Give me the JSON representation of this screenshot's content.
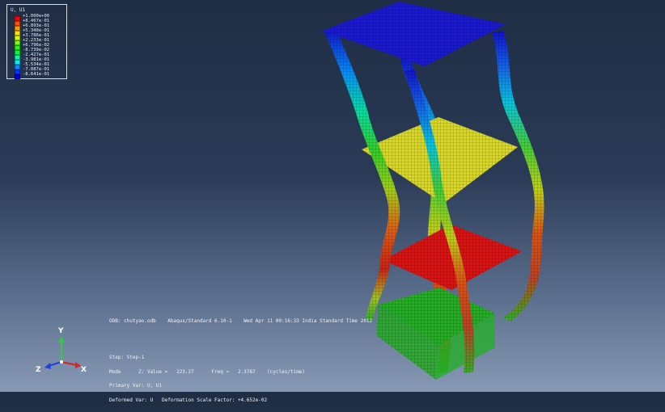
{
  "legend": {
    "title": "U, U1",
    "entries": [
      {
        "label": "+1.000e+00",
        "color": "#ff0000"
      },
      {
        "label": "+8.467e-01",
        "color": "#ff4e00"
      },
      {
        "label": "+6.893e-01",
        "color": "#ff9a00"
      },
      {
        "label": "+5.340e-01",
        "color": "#ffe000"
      },
      {
        "label": "+3.786e-01",
        "color": "#d4ff00"
      },
      {
        "label": "+2.233e-01",
        "color": "#7dff00"
      },
      {
        "label": "+6.796e-02",
        "color": "#1eff00"
      },
      {
        "label": "-8.739e-02",
        "color": "#00ff3c"
      },
      {
        "label": "-2.427e-01",
        "color": "#00ffa0"
      },
      {
        "label": "-3.981e-01",
        "color": "#00f0ff"
      },
      {
        "label": "-5.534e-01",
        "color": "#0090ff"
      },
      {
        "label": "-7.087e-01",
        "color": "#0036ff"
      },
      {
        "label": "-8.641e-01",
        "color": "#0000e0"
      }
    ]
  },
  "info": {
    "odb_line": "ODB: chutyao.odb    Abaqus/Standard 6.10-1    Wed Apr 11 00:16:33 India Standard Time 2012",
    "step": "Step: Step-1",
    "mode": "Mode      Z: Value =   223.27      Freq =   2.3787    (cycles/time)",
    "primary_var": "Primary Var: U, U1",
    "deformed_var": "Deformed Var: U   Deformation Scale Factor: +4.652e-02"
  },
  "triad": {
    "x_label": "X",
    "y_label": "Y",
    "z_label": "Z"
  },
  "colors": {
    "top_plate": "#1818d8",
    "middle_plate": "#d8d820",
    "lower_plate": "#e01010",
    "base_plate": "#20b020"
  }
}
